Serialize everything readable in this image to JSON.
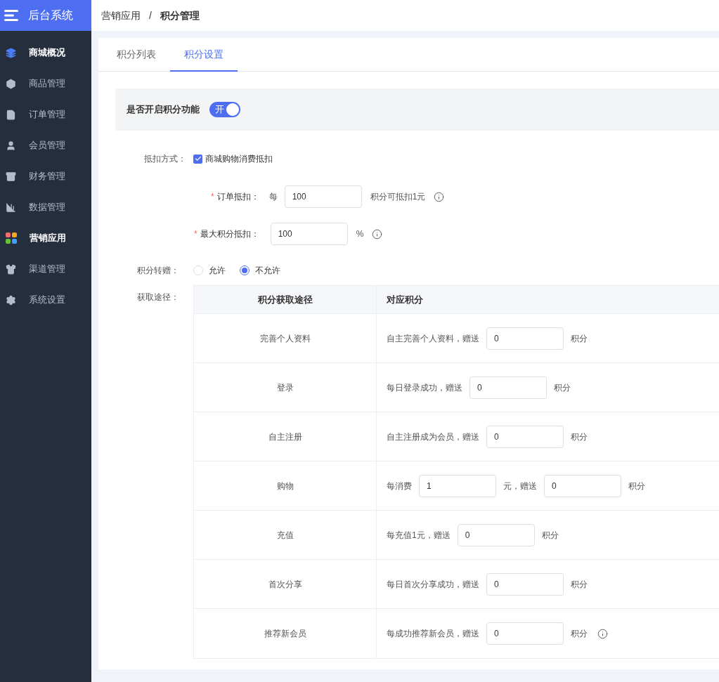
{
  "app": {
    "title": "后台系统"
  },
  "sidebar": {
    "items": [
      {
        "label": "商城概况",
        "highlighted": true
      },
      {
        "label": "商品管理",
        "highlighted": false
      },
      {
        "label": "订单管理",
        "highlighted": false
      },
      {
        "label": "会员管理",
        "highlighted": false
      },
      {
        "label": "财务管理",
        "highlighted": false
      },
      {
        "label": "数据管理",
        "highlighted": false
      },
      {
        "label": "营销应用",
        "highlighted": true
      },
      {
        "label": "渠道管理",
        "highlighted": false
      },
      {
        "label": "系统设置",
        "highlighted": false
      }
    ]
  },
  "breadcrumb": {
    "parent": "营销应用",
    "separator": "/",
    "current": "积分管理"
  },
  "tabs": [
    {
      "label": "积分列表",
      "selected": false
    },
    {
      "label": "积分设置",
      "selected": true
    }
  ],
  "switch": {
    "label": "是否开启积分功能",
    "on": true,
    "text": "开"
  },
  "deduction": {
    "label": "抵扣方式：",
    "option": "商城购物消费抵扣",
    "checked": true
  },
  "order_deduction": {
    "label": "订单抵扣：",
    "required": "*",
    "prefix": "每",
    "value": "100",
    "suffix": "积分可抵扣1元"
  },
  "max_deduction": {
    "label": "最大积分抵扣：",
    "required": "*",
    "value": "100",
    "suffix": "%"
  },
  "transfer": {
    "label": "积分转赠：",
    "options": [
      {
        "label": "允许",
        "selected": false
      },
      {
        "label": "不允许",
        "selected": true
      }
    ]
  },
  "sources": {
    "label": "获取途径：",
    "columns": [
      "积分获取途径",
      "对应积分"
    ],
    "rows": [
      {
        "name": "完善个人资料",
        "parts": [
          {
            "kind": "text",
            "text": "自主完善个人资料，赠送"
          },
          {
            "kind": "input",
            "value": "0"
          },
          {
            "kind": "text",
            "text": "积分"
          }
        ]
      },
      {
        "name": "登录",
        "parts": [
          {
            "kind": "text",
            "text": "每日登录成功，赠送"
          },
          {
            "kind": "input",
            "value": "0"
          },
          {
            "kind": "text",
            "text": "积分"
          }
        ]
      },
      {
        "name": "自主注册",
        "parts": [
          {
            "kind": "text",
            "text": "自主注册成为会员，赠送"
          },
          {
            "kind": "input",
            "value": "0"
          },
          {
            "kind": "text",
            "text": "积分"
          }
        ]
      },
      {
        "name": "购物",
        "parts": [
          {
            "kind": "text",
            "text": "每消费"
          },
          {
            "kind": "input",
            "value": "1"
          },
          {
            "kind": "text",
            "text": "元，赠送"
          },
          {
            "kind": "input",
            "value": "0"
          },
          {
            "kind": "text",
            "text": "积分"
          }
        ]
      },
      {
        "name": "充值",
        "parts": [
          {
            "kind": "text",
            "text": "每充值1元，赠送"
          },
          {
            "kind": "input",
            "value": "0"
          },
          {
            "kind": "text",
            "text": "积分"
          }
        ]
      },
      {
        "name": "首次分享",
        "parts": [
          {
            "kind": "text",
            "text": "每日首次分享成功，赠送"
          },
          {
            "kind": "input",
            "value": "0"
          },
          {
            "kind": "text",
            "text": "积分"
          }
        ]
      },
      {
        "name": "推荐新会员",
        "parts": [
          {
            "kind": "text",
            "text": "每成功推荐新会员，赠送"
          },
          {
            "kind": "input",
            "value": "0"
          },
          {
            "kind": "text",
            "text": "积分"
          },
          {
            "kind": "info"
          }
        ]
      }
    ]
  }
}
